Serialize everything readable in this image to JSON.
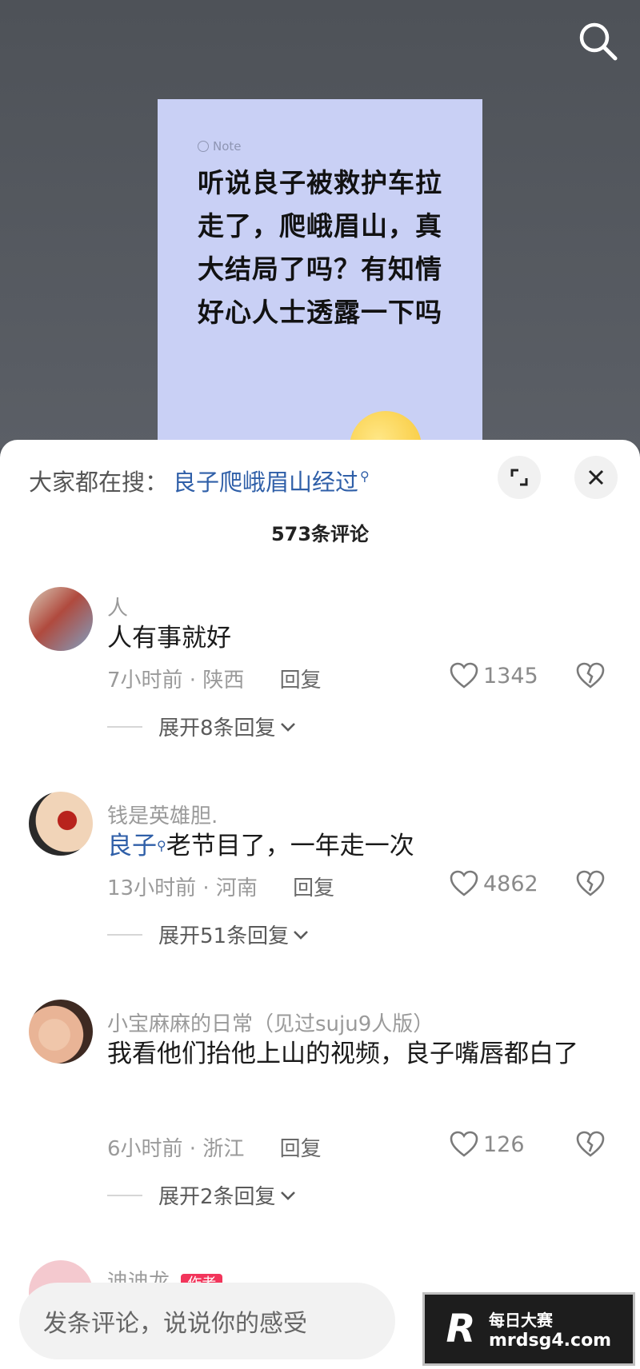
{
  "header": {
    "search_icon": "search-icon"
  },
  "note": {
    "label": "Note",
    "text": "听说良子被救护车拉走了，爬峨眉山，真大结局了吗？有知情好心人士透露一下吗"
  },
  "sheet": {
    "hot_search_prefix": "大家都在搜：",
    "hot_search_term": "良子爬峨眉山经过",
    "comment_count": "573条评论",
    "expand_icon": "expand-icon",
    "close_icon": "close-icon"
  },
  "comments": [
    {
      "username": "人",
      "text": "人有事就好",
      "time": "7小时前 · 陕西",
      "reply_label": "回复",
      "likes": "1345",
      "expand": "展开8条回复"
    },
    {
      "username": "钱是英雄胆.",
      "mention": "良子",
      "text": "老节目了，一年走一次",
      "time": "13小时前 · 河南",
      "reply_label": "回复",
      "likes": "4862",
      "expand": "展开51条回复"
    },
    {
      "username": "小宝麻麻的日常（见过suju9人版）",
      "text": "我看他们抬他上山的视频，良子嘴唇都白了",
      "time": "6小时前 · 浙江",
      "reply_label": "回复",
      "likes": "126",
      "expand": "展开2条回复"
    },
    {
      "username": "迪迪龙",
      "author_tag": "作者"
    }
  ],
  "input": {
    "placeholder": "发条评论，说说你的感受"
  },
  "watermark": {
    "line1": "每日大赛",
    "line2": "mrdsg4.com"
  },
  "colors": {
    "mention": "#2f5fa8",
    "author_tag": "#f2355b",
    "note_bg": "#c9d0f5"
  }
}
